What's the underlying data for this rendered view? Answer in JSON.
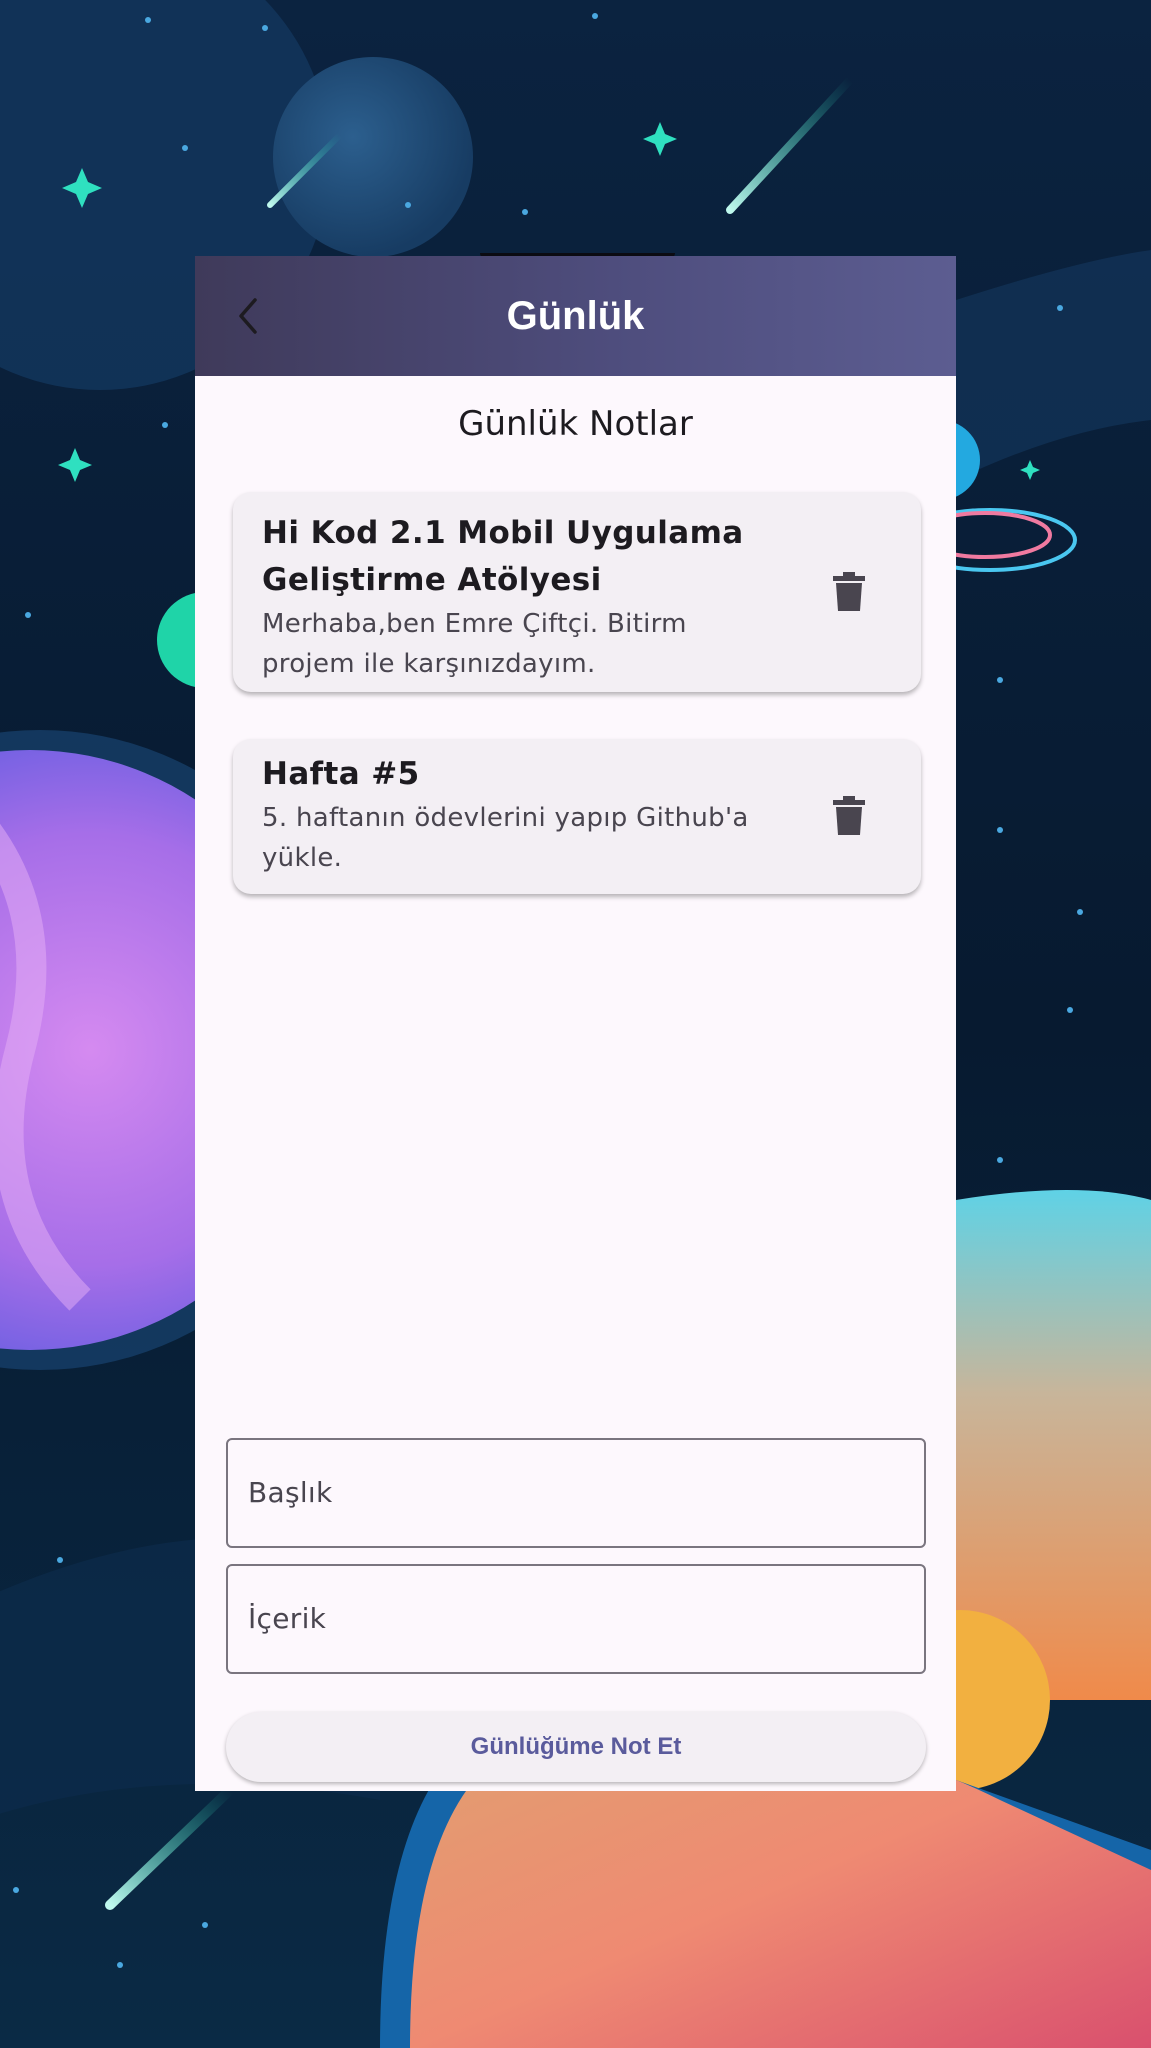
{
  "appbar": {
    "title": "Günlük",
    "back_icon": "chevron-left-icon"
  },
  "main": {
    "section_title": "Günlük Notlar",
    "notes": [
      {
        "title": "Hi Kod 2.1 Mobil Uygulama Geliştirme Atölyesi",
        "body": "Merhaba,ben Emre Çiftçi. Bitirm projem ile karşınızdayım.",
        "delete_icon": "trash-icon"
      },
      {
        "title": "Hafta #5",
        "body": "5. haftanın ödevlerini yapıp Github'a yükle.",
        "delete_icon": "trash-icon"
      }
    ]
  },
  "form": {
    "title_placeholder": "Başlık",
    "content_placeholder": "İçerik",
    "submit_label": "Günlüğüme Not Et"
  },
  "colors": {
    "appbar_start": "#3f3a5a",
    "appbar_end": "#5c5d91",
    "surface": "#fdf8fd",
    "card": "#f3eff4",
    "accent": "#5a5b9c",
    "icon": "#49454f"
  }
}
